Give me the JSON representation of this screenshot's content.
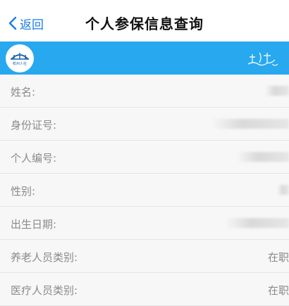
{
  "nav": {
    "back_label": "返回",
    "title": "个人参保信息查询"
  },
  "banner": {
    "logo_text": "杭州人社",
    "background": "#27a8ef"
  },
  "fields": [
    {
      "label": "姓名:",
      "value": ""
    },
    {
      "label": "身份证号:",
      "value": ""
    },
    {
      "label": "个人编号:",
      "value": ""
    },
    {
      "label": "性别:",
      "value": ""
    },
    {
      "label": "出生日期:",
      "value": ""
    },
    {
      "label": "养老人员类别:",
      "value": "在职"
    },
    {
      "label": "医疗人员类别:",
      "value": "在职"
    }
  ],
  "colors": {
    "accent": "#1a7ce6",
    "row_background": "#f7f7f7",
    "label_text": "#8a8a8a"
  }
}
